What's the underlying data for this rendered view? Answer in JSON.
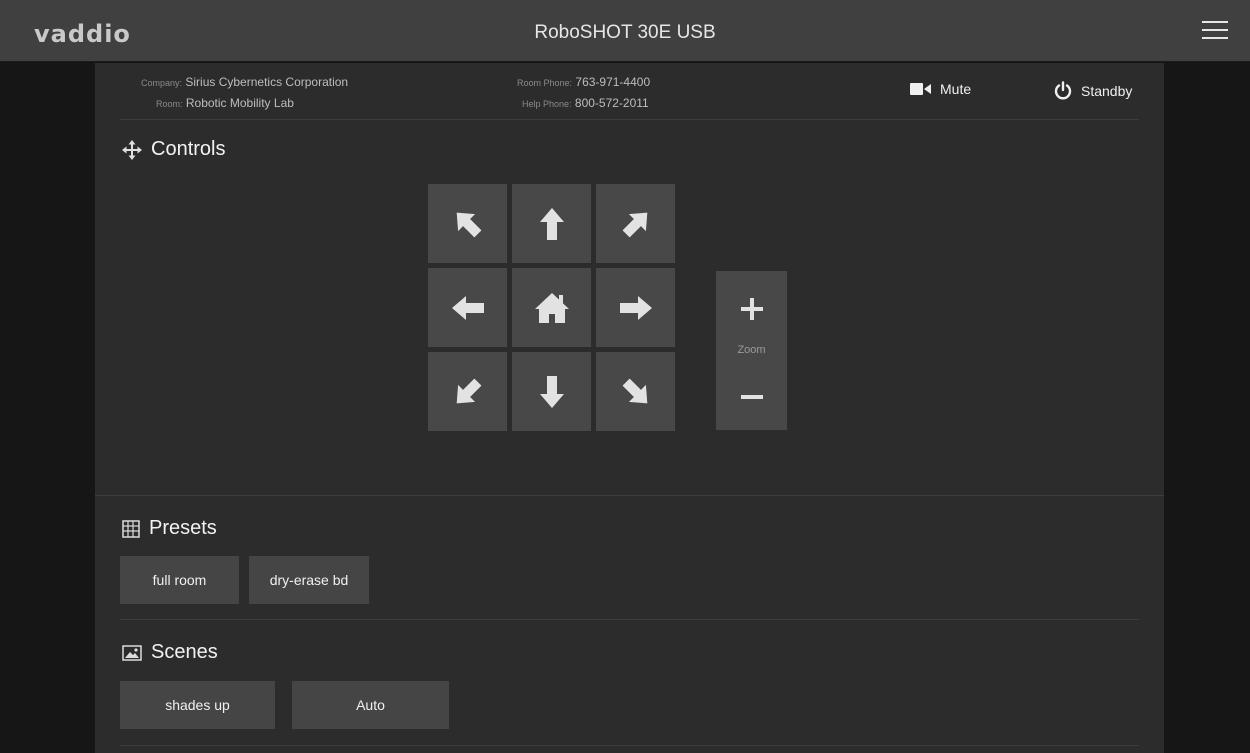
{
  "app": {
    "logo": "vaddio",
    "title": "RoboSHOT 30E USB"
  },
  "info": {
    "company_label": "Company:",
    "company": "Sirius Cybernetics Corporation",
    "room_label": "Room:",
    "room": "Robotic Mobility Lab",
    "room_phone_label": "Room Phone:",
    "room_phone": "763-971-4400",
    "help_phone_label": "Help Phone:",
    "help_phone": "800-572-2011"
  },
  "header_buttons": {
    "mute": "Mute",
    "standby": "Standby"
  },
  "controls": {
    "title": "Controls",
    "zoom_label": "Zoom"
  },
  "presets": {
    "title": "Presets",
    "items": [
      "full room",
      "dry-erase bd"
    ]
  },
  "scenes": {
    "title": "Scenes",
    "items": [
      "shades up",
      "Auto"
    ]
  },
  "colors": {
    "topbar": "#404040",
    "panel": "#2c2c2c",
    "button": "#484848",
    "icon": "#e2e2e2"
  }
}
